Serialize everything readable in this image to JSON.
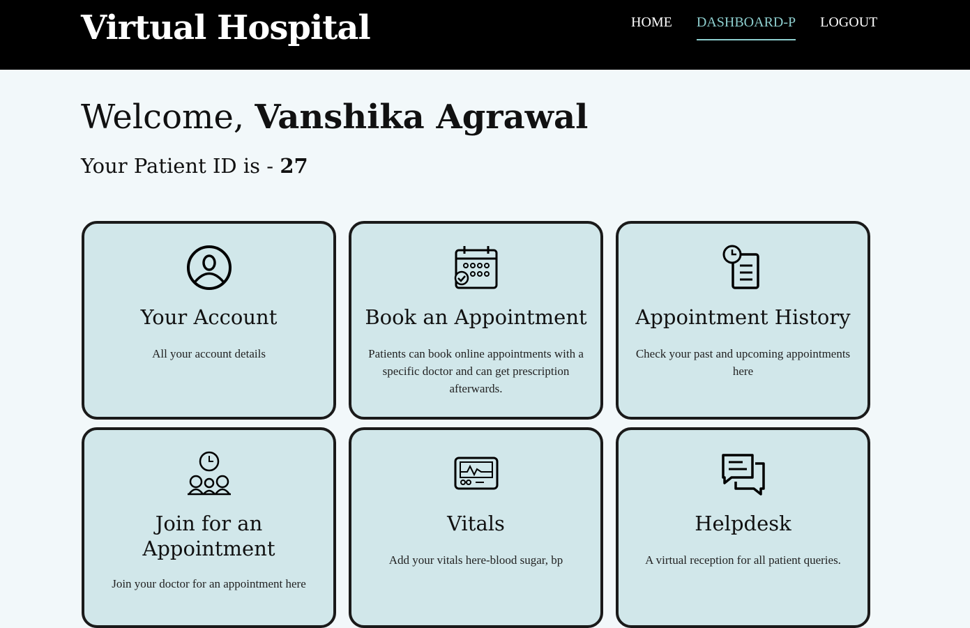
{
  "header": {
    "brand": "Virtual Hospital",
    "nav": [
      {
        "label": "HOME"
      },
      {
        "label": "DASHBOARD-P"
      },
      {
        "label": "LOGOUT"
      }
    ]
  },
  "welcome": {
    "prefix": "Welcome, ",
    "name": "Vanshika Agrawal",
    "pid_prefix": "Your Patient ID is - ",
    "pid": "27"
  },
  "cards": [
    {
      "title": "Your Account",
      "desc": "All your account details",
      "icon": "user-account-icon"
    },
    {
      "title": "Book an Appointment",
      "desc": "Patients can book online appointments with a specific doctor and can get prescription afterwards.",
      "icon": "calendar-icon"
    },
    {
      "title": "Appointment History",
      "desc": "Check your past and upcoming appointments here",
      "icon": "history-clipboard-icon"
    },
    {
      "title": "Join for an Appointment",
      "desc": "Join your doctor for an appointment here",
      "icon": "video-meeting-icon"
    },
    {
      "title": "Vitals",
      "desc": "Add your vitals here-blood sugar, bp",
      "icon": "vitals-monitor-icon"
    },
    {
      "title": "Helpdesk",
      "desc": "A virtual reception for all patient queries.",
      "icon": "chat-bubbles-icon"
    }
  ]
}
